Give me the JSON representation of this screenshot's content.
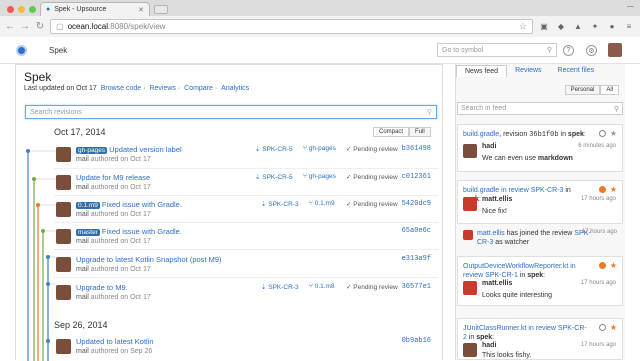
{
  "browser": {
    "tab_title": "Spek - Upsource",
    "url_host": "ocean.local",
    "url_path": ":8080/spek/view",
    "person": "—"
  },
  "app": {
    "name": "Spek",
    "goto_placeholder": "Go to symbol"
  },
  "main": {
    "title": "Spek",
    "last_updated": "Last updated on Oct 17",
    "links": [
      "Browse code",
      "Reviews",
      "Compare",
      "Analytics"
    ],
    "search_placeholder": "Search revisions",
    "view_toggle": [
      "Compact",
      "Full"
    ],
    "dates": [
      "Oct 17, 2014",
      "Sep 26, 2014"
    ],
    "revisions": [
      {
        "tag": "gh-pages",
        "message": "Updated version label",
        "author": "mail",
        "date_text": "authored on Oct 17",
        "review": "SPK-CR-5",
        "branch": "gh-pages",
        "status": "✓ Pending review",
        "hash": "b361498"
      },
      {
        "tag": "",
        "message": "Update for M9 release",
        "author": "mail",
        "date_text": "authored on Oct 17",
        "review": "SPK-CR-5",
        "branch": "gh-pages",
        "status": "✓ Pending review",
        "hash": "c012361"
      },
      {
        "tag": "0.1.m9",
        "message": "Fixed issue with Gradle.",
        "author": "mail",
        "date_text": "authored on Oct 17",
        "review": "SPK-CR-3",
        "branch": "0.1.m9",
        "status": "✓ Pending review",
        "hash": "5420dc9"
      },
      {
        "tag": "master",
        "message": "Fixed issue with Gradle.",
        "author": "mail",
        "date_text": "authored on Oct 17",
        "review": "",
        "branch": "",
        "status": "",
        "hash": "65a0e6c"
      },
      {
        "tag": "",
        "message": "Upgrade to latest Kotlin Snapshot (post M9)",
        "author": "mail",
        "date_text": "authored on Oct 17",
        "review": "",
        "branch": "",
        "status": "",
        "hash": "e313a9f"
      },
      {
        "tag": "",
        "message": "Upgrade to M9.",
        "author": "mail",
        "date_text": "authored on Oct 17",
        "review": "SPK-CR-3",
        "branch": "0.1.m8",
        "status": "✓ Pending review",
        "hash": "36577e1"
      },
      {
        "tag": "",
        "message": "Updated to latest Kotlin",
        "author": "mail",
        "date_text": "authored on Sep 26",
        "review": "",
        "branch": "",
        "status": "",
        "hash": "0b9ab16"
      }
    ]
  },
  "side": {
    "tabs": [
      "News feed",
      "Reviews",
      "Recent files"
    ],
    "filter": [
      "Personal",
      "All"
    ],
    "search_placeholder": "Search in feed",
    "items": [
      {
        "file": "build.gradle",
        "text": ", revision ",
        "hash": "36b1f0b",
        "in": " in ",
        "proj": "spek",
        "user": "hadi",
        "time": "6 minutes ago",
        "body_pre": "We can even use ",
        "body_bold": "markdown"
      },
      {
        "file": "build.gradle in review SPK-CR-3",
        "in": " in ",
        "proj": "spek",
        "user": "matt.ellis",
        "time": "17 hours ago",
        "body": "Nice fix!"
      },
      {
        "actor": "matt.ellis",
        "action": " has joined the review ",
        "review": "SPK-CR-3",
        "tail": " as watcher",
        "time": "17 hours ago"
      },
      {
        "file": "OutputDeviceWorkflowReporter.kt in review SPK-CR-1",
        "in": " in ",
        "proj": "spek",
        "user": "matt.ellis",
        "time": "17 hours ago",
        "body": "Looks quite interesting"
      },
      {
        "file": "JUnitClassRunner.kt in review SPK-CR-2",
        "in": " in ",
        "proj": "spek",
        "user": "hadi",
        "time": "17 hours ago",
        "body": "This looks fishy."
      }
    ]
  },
  "colors": {
    "accent": "#2e6ec7",
    "orange": "#e87a2c",
    "tag": "#2f6ea8"
  }
}
